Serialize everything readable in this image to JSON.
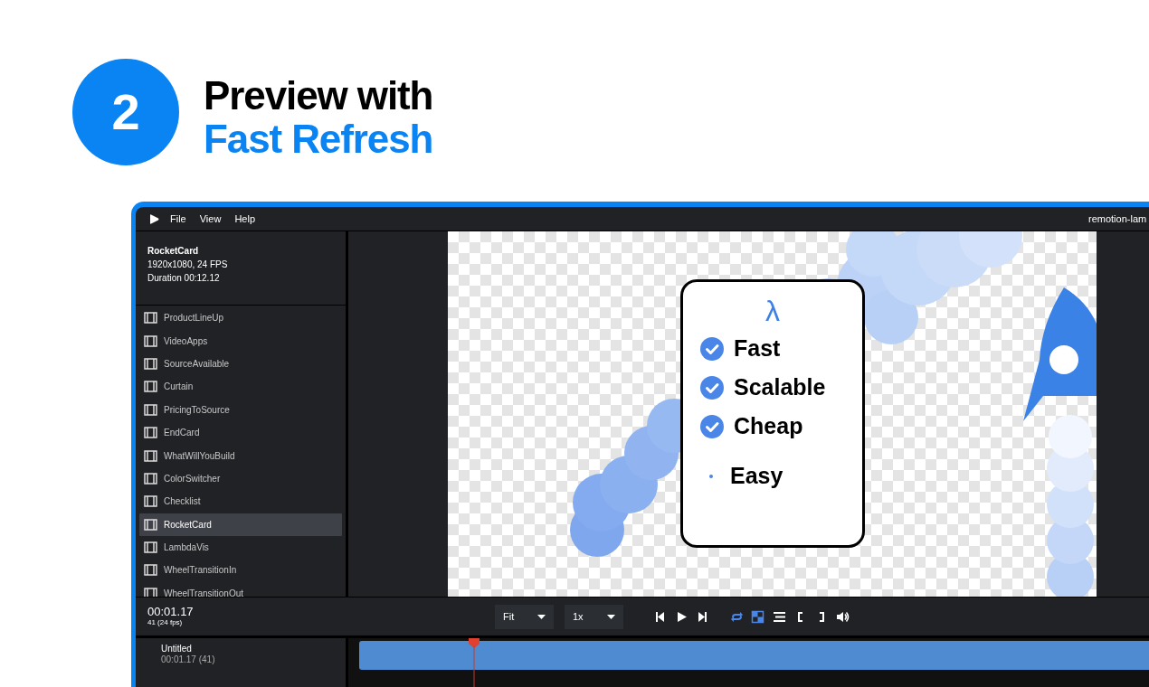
{
  "step": {
    "number": "2",
    "title_line_1": "Preview with",
    "title_line_2": "Fast Refresh"
  },
  "app": {
    "menu": [
      "File",
      "View",
      "Help"
    ],
    "window_title": "remotion-lam",
    "composition_info": {
      "name": "RocketCard",
      "format": "1920x1080, 24 FPS",
      "duration": "Duration 00:12.12"
    },
    "compositions": [
      {
        "label": "ProductLineUp",
        "selected": false
      },
      {
        "label": "VideoApps",
        "selected": false
      },
      {
        "label": "SourceAvailable",
        "selected": false
      },
      {
        "label": "Curtain",
        "selected": false
      },
      {
        "label": "PricingToSource",
        "selected": false
      },
      {
        "label": "EndCard",
        "selected": false
      },
      {
        "label": "WhatWillYouBuild",
        "selected": false
      },
      {
        "label": "ColorSwitcher",
        "selected": false
      },
      {
        "label": "Checklist",
        "selected": false
      },
      {
        "label": "RocketCard",
        "selected": true
      },
      {
        "label": "LambdaVis",
        "selected": false
      },
      {
        "label": "WheelTransitionIn",
        "selected": false
      },
      {
        "label": "WheelTransitionOut",
        "selected": false
      }
    ],
    "card": {
      "symbol": "λ",
      "items": [
        {
          "label": "Fast",
          "checked": true
        },
        {
          "label": "Scalable",
          "checked": true
        },
        {
          "label": "Cheap",
          "checked": true
        },
        {
          "label": "Easy",
          "checked": false
        }
      ]
    },
    "time": "00:01.17",
    "frame": "41 (24 fps)",
    "dropdowns": [
      "Fit",
      "1x"
    ],
    "toolbar": [
      {
        "kind": "skip-back",
        "on": false
      },
      {
        "kind": "play",
        "on": false
      },
      {
        "kind": "skip-forward",
        "on": false
      },
      {
        "kind": "loop",
        "on": true
      },
      {
        "kind": "checkerboard",
        "on": true
      },
      {
        "kind": "timeline",
        "on": false
      },
      {
        "kind": "in-mark",
        "on": false
      },
      {
        "kind": "out-mark",
        "on": false
      },
      {
        "kind": "volume",
        "on": false
      }
    ],
    "track": {
      "name": "Untitled",
      "time": "00:01.17 (41)"
    }
  }
}
